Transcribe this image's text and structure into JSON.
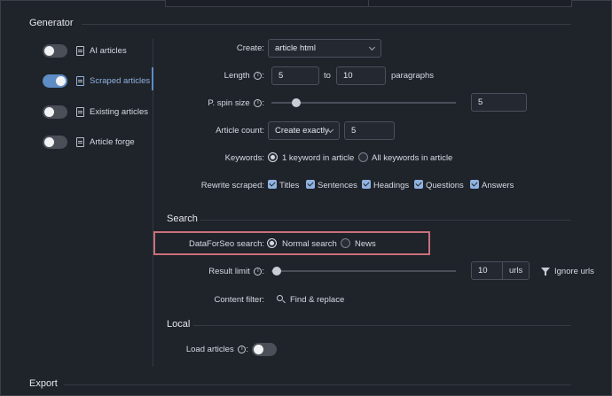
{
  "generator": {
    "title": "Generator"
  },
  "export": {
    "title": "Export"
  },
  "sidebar": {
    "items": [
      {
        "label": "AI articles",
        "on": false
      },
      {
        "label": "Scraped articles",
        "on": true
      },
      {
        "label": "Existing articles",
        "on": false
      },
      {
        "label": "Article forge",
        "on": false
      }
    ]
  },
  "form": {
    "create": {
      "label": "Create:",
      "value": "article html"
    },
    "length": {
      "label": "Length",
      "colon": ":",
      "min": "5",
      "to": "to",
      "max": "10",
      "unit": "paragraphs"
    },
    "spin": {
      "label": "P. spin size",
      "colon": ":",
      "value": "5",
      "level": 0.05
    },
    "count": {
      "label": "Article count:",
      "mode": "Create exactly",
      "value": "5"
    },
    "keywords": {
      "label": "Keywords:",
      "opt1": "1 keyword in article",
      "opt2": "All keywords in article"
    },
    "rewrite": {
      "label": "Rewrite scraped:",
      "items": [
        "Titles",
        "Sentences",
        "Headings",
        "Questions",
        "Answers"
      ]
    }
  },
  "search": {
    "title": "Search",
    "dataforseo": {
      "label": "DataForSeo search:",
      "opt1": "Normal search",
      "opt2": "News"
    },
    "limit": {
      "label": "Result limit",
      "colon": ":",
      "value": "10",
      "unit": "urls",
      "level": 0.02
    },
    "ignore": "Ignore urls",
    "filter": {
      "label": "Content filter:",
      "action": "Find & replace"
    }
  },
  "local": {
    "title": "Local",
    "load": {
      "label": "Load articles",
      "colon": ":",
      "on": false
    }
  }
}
